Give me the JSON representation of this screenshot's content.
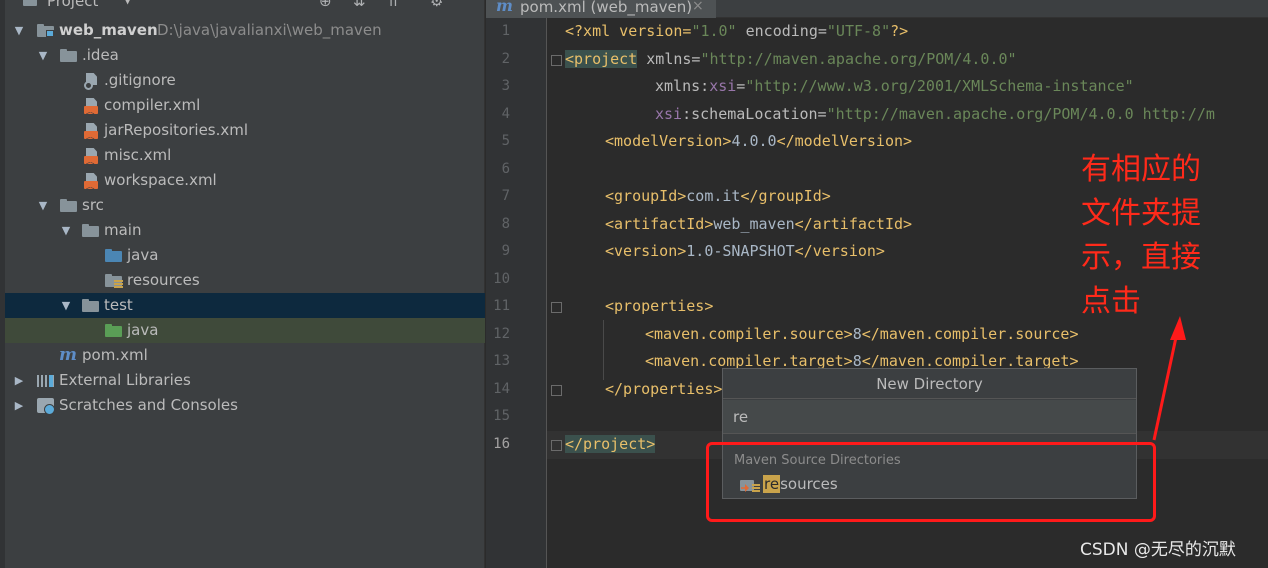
{
  "project_panel": {
    "title": "Project",
    "header_icons": [
      "locate-icon",
      "collapse-all-icon",
      "expand-icon",
      "gear-icon"
    ],
    "root": {
      "name": "web_maven",
      "path": "D:\\java\\javalianxi\\web_maven"
    },
    "idea_folder": ".idea",
    "idea_files": [
      ".gitignore",
      "compiler.xml",
      "jarRepositories.xml",
      "misc.xml",
      "workspace.xml"
    ],
    "src": "src",
    "main": "main",
    "main_java": "java",
    "main_resources": "resources",
    "test": "test",
    "test_java": "java",
    "pom": "pom.xml",
    "external_libraries": "External Libraries",
    "scratches": "Scratches and Consoles"
  },
  "editor": {
    "tab_label": "pom.xml (web_maven)",
    "line_numbers": [
      "1",
      "2",
      "3",
      "4",
      "5",
      "6",
      "7",
      "8",
      "9",
      "10",
      "11",
      "12",
      "13",
      "14",
      "15",
      "16"
    ],
    "current_line": "16",
    "code": {
      "l1": {
        "a": "<?xml version=",
        "b": "\"1.0\"",
        "c": " encoding=",
        "d": "\"UTF-8\"",
        "e": "?>"
      },
      "l2": {
        "a": "<project",
        "b": " xmlns=",
        "c": "\"http://maven.apache.org/POM/4.0.0\""
      },
      "l3": {
        "a": "xmlns:",
        "b": "xsi",
        "c": "=",
        "d": "\"http://www.w3.org/2001/XMLSchema-instance\""
      },
      "l4": {
        "a": "xsi",
        "b": ":schemaLocation=",
        "c": "\"http://maven.apache.org/POM/4.0.0 http://m"
      },
      "l5": {
        "a": "<modelVersion>",
        "b": "4.0.0",
        "c": "</modelVersion>"
      },
      "l7": {
        "a": "<groupId>",
        "b": "com.it",
        "c": "</groupId>"
      },
      "l8": {
        "a": "<artifactId>",
        "b": "web_maven",
        "c": "</artifactId>"
      },
      "l9": {
        "a": "<version>",
        "b": "1.0-SNAPSHOT",
        "c": "</version>"
      },
      "l11": {
        "a": "<properties>"
      },
      "l12": {
        "a": "<maven.compiler.source>",
        "b": "8",
        "c": "</maven.compiler.source>"
      },
      "l13": {
        "a": "<maven.compiler.target>",
        "b": "8",
        "c": "</maven.compiler.target>"
      },
      "l14": {
        "a": "</properties>"
      },
      "l16": {
        "a": "</project>"
      }
    }
  },
  "popup": {
    "title": "New Directory",
    "input_value": "re",
    "section_label": "Maven Source Directories",
    "item_match": "re",
    "item_rest": "sources"
  },
  "annotation": {
    "lines": [
      "有相应的",
      "文件夹提",
      "示，直接",
      "点击"
    ],
    "color": "#ff1a1a"
  },
  "watermark": "CSDN @无尽的沉默"
}
